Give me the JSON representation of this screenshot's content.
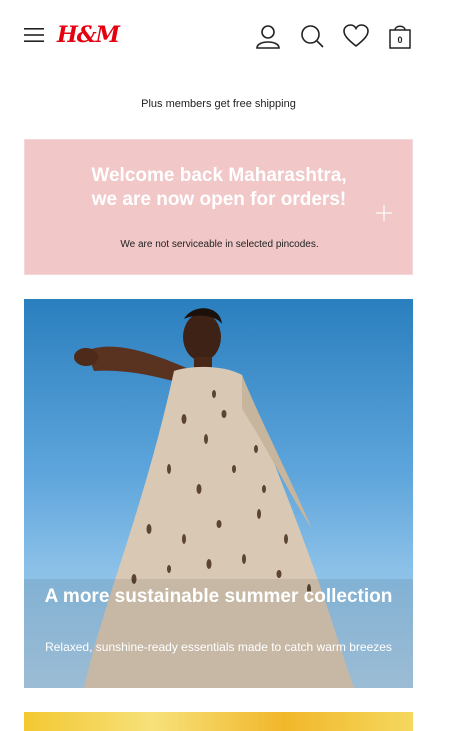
{
  "header": {
    "logo_text": "H&M",
    "bag_count": "0",
    "brand_color": "#e50010"
  },
  "promo": {
    "text": "Plus members get free shipping"
  },
  "welcome_banner": {
    "title": "Welcome back Maharashtra, we are now open for orders!",
    "subtitle": "We are not serviceable in selected pincodes.",
    "bg_color": "#f1c7c8"
  },
  "hero": {
    "title": "A more sustainable summer collection",
    "subtitle": "Relaxed, sunshine-ready essentials made to catch warm breezes"
  },
  "icons": [
    "menu-icon",
    "account-icon",
    "search-icon",
    "heart-icon",
    "bag-icon",
    "plus-icon"
  ]
}
